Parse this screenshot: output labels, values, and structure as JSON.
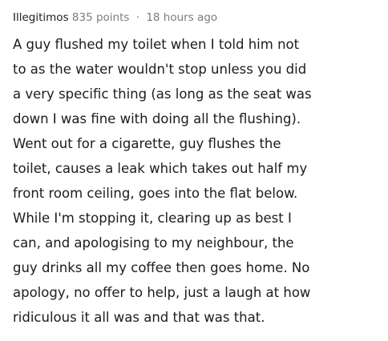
{
  "comment": {
    "author": "Illegitimos",
    "points": "835 points",
    "separator": "·",
    "timestamp": "18 hours ago",
    "lines": [
      "A guy flushed my toilet when I told him not",
      "to as the water wouldn't stop unless you did",
      "a very specific thing (as long as the seat was",
      "down I was fine with doing all the flushing).",
      "Went out for a cigarette, guy flushes the",
      "toilet, causes a leak which takes out half my",
      "front room ceiling, goes into the flat below.",
      "While I'm stopping it, clearing up as best I",
      "can, and apologising to my neighbour, the",
      "guy drinks all my coffee then goes home. No",
      "apology, no offer to help, just a laugh at how",
      "ridiculous it all was and that was that."
    ]
  }
}
